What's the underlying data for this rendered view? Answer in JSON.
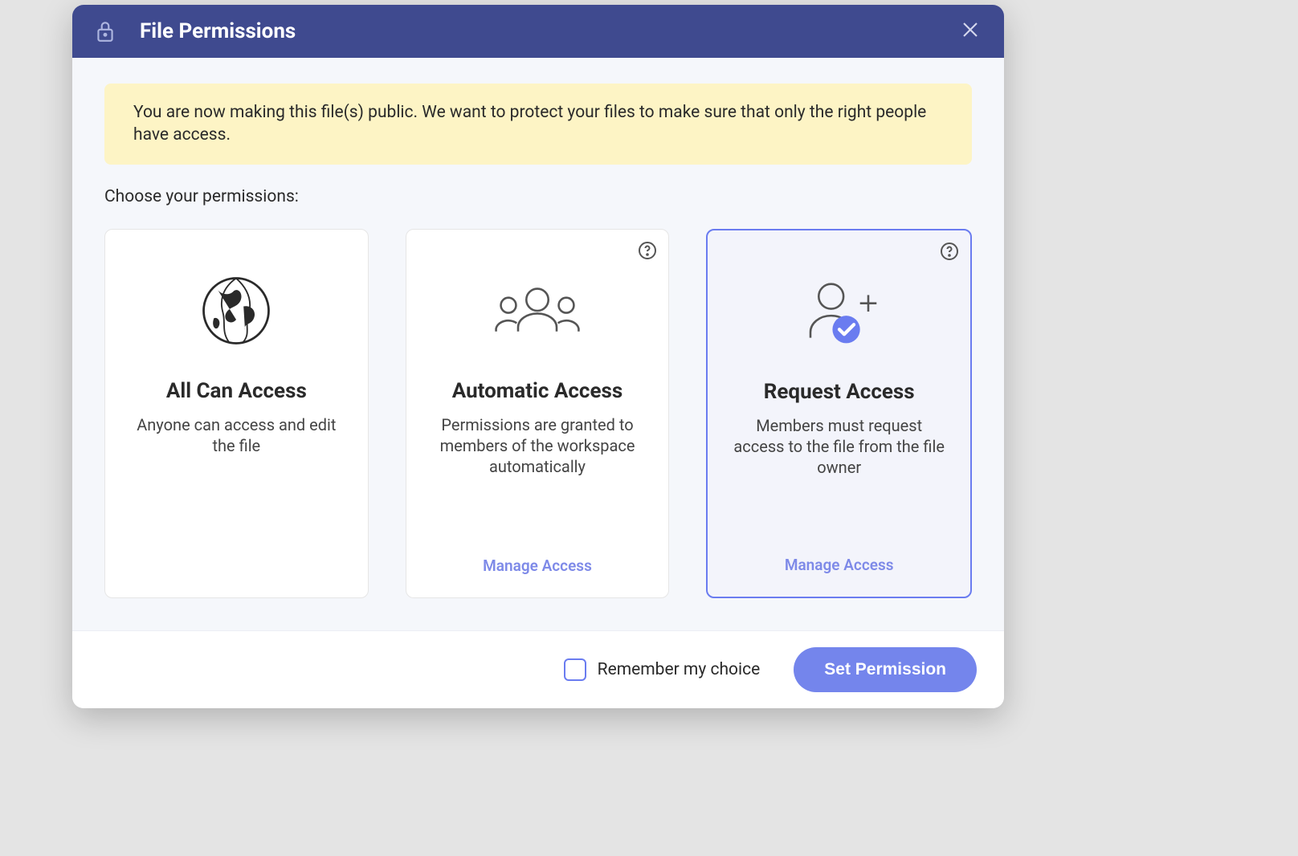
{
  "dialog": {
    "title": "File Permissions",
    "banner": "You are now making this file(s) public. We want to protect your files to make sure that only the right people have access.",
    "choose_label": "Choose your permissions:"
  },
  "cards": [
    {
      "title": "All Can Access",
      "desc": "Anyone can access and edit the file",
      "manage": null,
      "help": false,
      "selected": false
    },
    {
      "title": "Automatic Access",
      "desc": "Permissions are granted to members of the workspace automatically",
      "manage": "Manage Access",
      "help": true,
      "selected": false
    },
    {
      "title": "Request Access",
      "desc": "Members must request access to the file from the file owner",
      "manage": "Manage Access",
      "help": true,
      "selected": true
    }
  ],
  "footer": {
    "remember_label": "Remember my choice",
    "primary_button": "Set Permission"
  }
}
